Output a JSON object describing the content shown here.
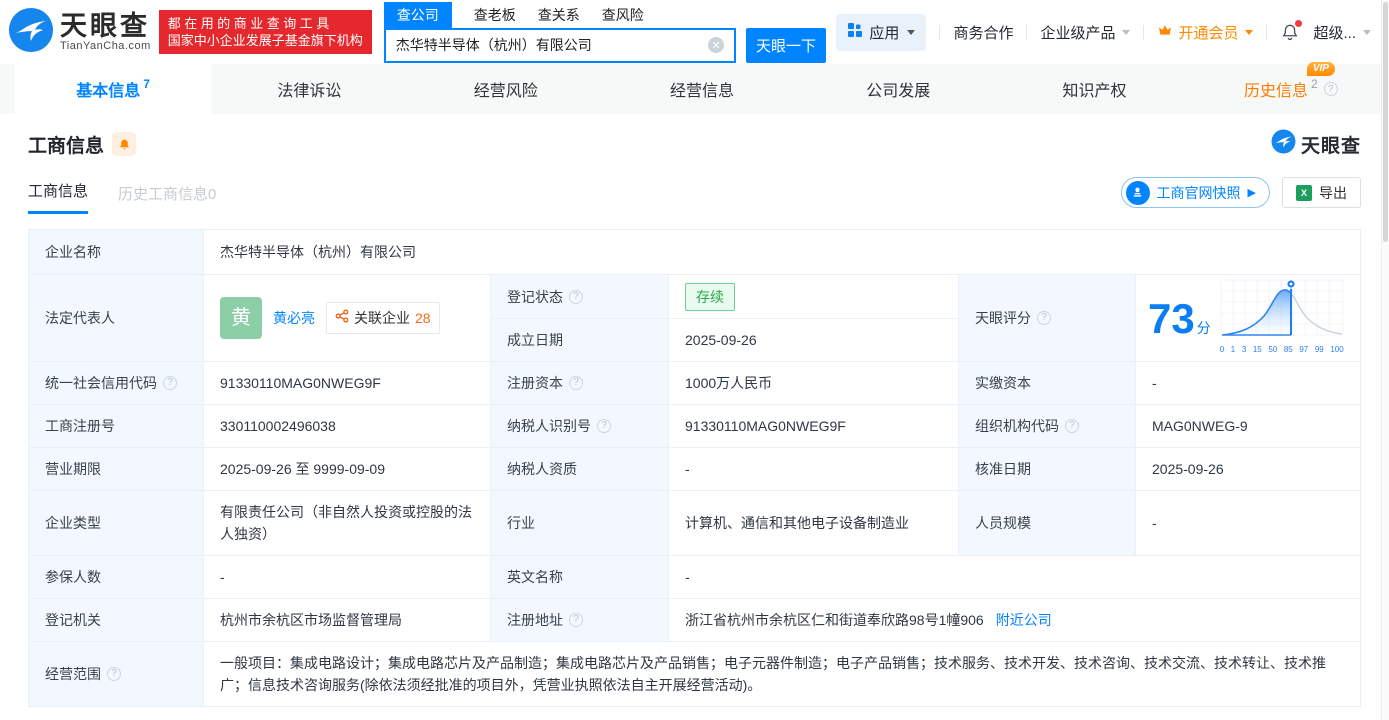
{
  "brand": {
    "name": "天眼查",
    "domain": "TianYanCha.com",
    "blue": "#0084ff",
    "orange": "#ff8a00",
    "red": "#e5272e",
    "green": "#23ad46"
  },
  "header": {
    "slogan_line1": "都在用的商业查询工具",
    "slogan_line2": "国家中小企业发展子基金旗下机构",
    "search_tabs": {
      "company": "查公司",
      "boss": "查老板",
      "relation": "查关系",
      "risk": "查风险"
    },
    "search_value": "杰华特半导体（杭州）有限公司",
    "search_button": "天眼一下",
    "menu": {
      "apps": "应用",
      "cooperation": "商务合作",
      "enterprise": "企业级产品",
      "vip": "开通会员",
      "super": "超级..."
    }
  },
  "nav": {
    "tabs": [
      {
        "label": "基本信息",
        "count": "7"
      },
      {
        "label": "法律诉讼"
      },
      {
        "label": "经营风险"
      },
      {
        "label": "经营信息"
      },
      {
        "label": "公司发展"
      },
      {
        "label": "知识产权"
      },
      {
        "label": "历史信息",
        "count": "2",
        "vip": "VIP"
      }
    ]
  },
  "section": {
    "title": "工商信息",
    "logo_text": "天眼查",
    "sub_tab_active": "工商信息",
    "sub_tab_history": "历史工商信息0",
    "snapshot_button": "工商官网快照",
    "export_button": "导出"
  },
  "table": {
    "company_name_label": "企业名称",
    "company_name": "杰华特半导体（杭州）有限公司",
    "legal_rep_label": "法定代表人",
    "avatar_char": "黄",
    "legal_rep_name": "黄必亮",
    "related_badge": "关联企业",
    "related_count": "28",
    "reg_status_label": "登记状态",
    "reg_status": "存续",
    "establish_label": "成立日期",
    "establish_date": "2025-09-26",
    "score_label": "天眼评分",
    "score_value": "73",
    "score_unit": "分",
    "rows": [
      {
        "l1": "统一社会信用代码",
        "v1": "91330110MAG0NWEG9F",
        "l2": "注册资本",
        "v2": "1000万人民币",
        "l3": "实缴资本",
        "v3": "-"
      },
      {
        "l1": "工商注册号",
        "v1": "330110002496038",
        "l2": "纳税人识别号",
        "v2": "91330110MAG0NWEG9F",
        "l3": "组织机构代码",
        "v3": "MAG0NWEG-9"
      },
      {
        "l1": "营业期限",
        "v1": "2025-09-26 至 9999-09-09",
        "l2": "纳税人资质",
        "v2": "-",
        "l3": "核准日期",
        "v3": "2025-09-26"
      },
      {
        "l1": "企业类型",
        "v1": "有限责任公司（非自然人投资或控股的法人独资）",
        "l2": "行业",
        "v2": "计算机、通信和其他电子设备制造业",
        "l3": "人员规模",
        "v3": "-"
      }
    ],
    "insured_label": "参保人数",
    "insured_value": "-",
    "english_name_label": "英文名称",
    "english_name_value": "-",
    "registry_label": "登记机关",
    "registry_value": "杭州市余杭区市场监督管理局",
    "address_label": "注册地址",
    "address_value": "浙江省杭州市余杭区仁和街道奉欣路98号1幢906",
    "address_link": "附近公司",
    "scope_label": "经营范围",
    "scope_value": "一般项目：集成电路设计；集成电路芯片及产品制造；集成电路芯片及产品销售；电子元器件制造；电子产品销售；技术服务、技术开发、技术咨询、技术交流、技术转让、技术推广；信息技术咨询服务(除依法须经批准的项目外，凭营业执照依法自主开展经营活动)。"
  },
  "chart_data": {
    "type": "area",
    "title": "天眼评分",
    "score": 73,
    "marker_value": 73,
    "x_tick_labels": [
      "0",
      "1",
      "3",
      "15",
      "50",
      "85",
      "97",
      "99",
      "100"
    ],
    "curve": "bell-distribution, blue fill left of marker at 73, gray line right of marker",
    "legend_position": "none",
    "grid": true
  }
}
